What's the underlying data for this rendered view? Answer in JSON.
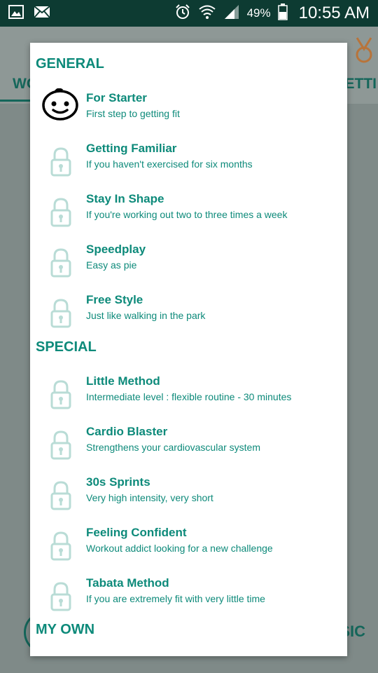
{
  "status_bar": {
    "battery": "49%",
    "time": "10:55 AM",
    "icons": [
      "gallery-icon",
      "mail-icon",
      "alarm-icon",
      "wifi-icon",
      "signal-icon",
      "battery-icon"
    ]
  },
  "background": {
    "tab_left": "WO",
    "tab_right": "ETTI",
    "bottom_right": "SIC"
  },
  "colors": {
    "accent": "#0d8a7a",
    "status_bar": "#0d3b32",
    "locked_icon": "#b9dcd6"
  },
  "dialog": {
    "sections": [
      {
        "header": "GENERAL",
        "items": [
          {
            "title": "For Starter",
            "subtitle": "First step to getting fit",
            "icon": "baby-face-icon",
            "locked": false
          },
          {
            "title": "Getting Familiar",
            "subtitle": "If you haven't exercised for six months",
            "icon": "lock-icon",
            "locked": true
          },
          {
            "title": "Stay In Shape",
            "subtitle": "If you're working out two to three times a week",
            "icon": "lock-icon",
            "locked": true
          },
          {
            "title": "Speedplay",
            "subtitle": "Easy as pie",
            "icon": "lock-icon",
            "locked": true
          },
          {
            "title": "Free Style",
            "subtitle": "Just like walking in the park",
            "icon": "lock-icon",
            "locked": true
          }
        ]
      },
      {
        "header": "SPECIAL",
        "items": [
          {
            "title": "Little Method",
            "subtitle": "Intermediate level : flexible routine - 30 minutes",
            "icon": "lock-icon",
            "locked": true
          },
          {
            "title": "Cardio Blaster",
            "subtitle": "Strengthens your cardiovascular system",
            "icon": "lock-icon",
            "locked": true
          },
          {
            "title": "30s Sprints",
            "subtitle": "Very high intensity, very short",
            "icon": "lock-icon",
            "locked": true
          },
          {
            "title": "Feeling Confident",
            "subtitle": "Workout addict looking for a new challenge",
            "icon": "lock-icon",
            "locked": true
          },
          {
            "title": "Tabata Method",
            "subtitle": "If you are extremely fit with very little time",
            "icon": "lock-icon",
            "locked": true
          }
        ]
      },
      {
        "header": "MY OWN",
        "items": []
      }
    ]
  }
}
